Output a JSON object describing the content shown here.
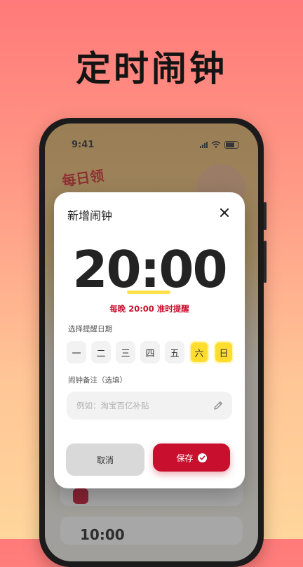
{
  "hero": {
    "title": "定时闹钟"
  },
  "status_bar": {
    "time": "9:41"
  },
  "background": {
    "banner_text": "每日领",
    "peek_time": "10:00"
  },
  "modal": {
    "title": "新增闹钟",
    "time_value": "20:00",
    "reminder_text": "每晚 20:00 准时提醒",
    "days_label": "选择提醒日期",
    "days": [
      {
        "label": "一",
        "selected": false
      },
      {
        "label": "二",
        "selected": false
      },
      {
        "label": "三",
        "selected": false
      },
      {
        "label": "四",
        "selected": false
      },
      {
        "label": "五",
        "selected": false
      },
      {
        "label": "六",
        "selected": true
      },
      {
        "label": "日",
        "selected": true
      }
    ],
    "note_label": "闹钟备注（选填）",
    "note_placeholder": "例如：淘宝百亿补贴",
    "note_value": "",
    "cancel_label": "取消",
    "save_label": "保存"
  },
  "colors": {
    "accent": "#c8102e",
    "highlight": "#ffdd2e"
  }
}
